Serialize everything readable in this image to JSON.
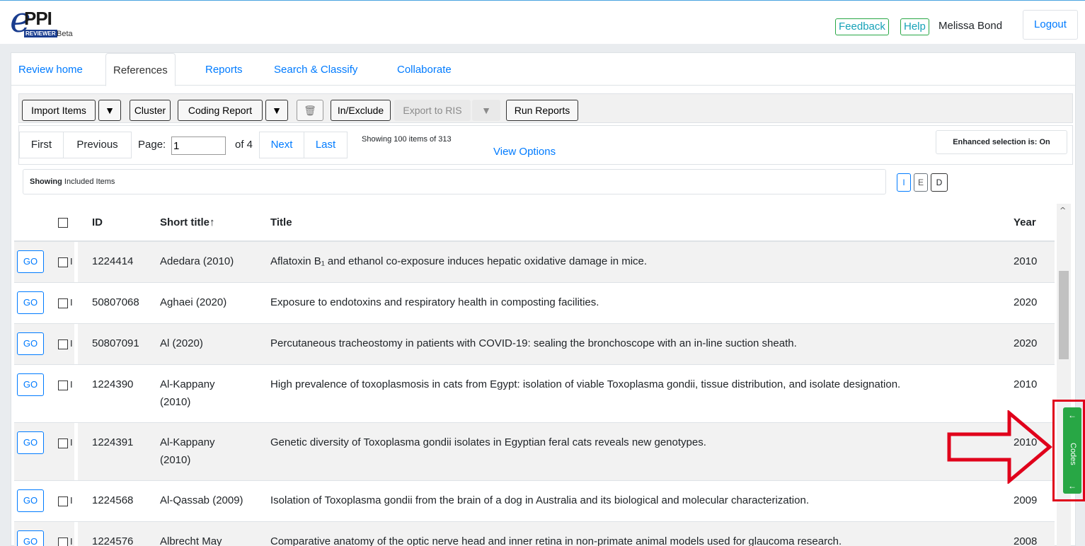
{
  "header": {
    "logo_text": "PPI",
    "logo_sub": "REVIEWER",
    "logo_beta": "Beta",
    "feedback_label": "Feedback",
    "help_label": "Help",
    "user_name": "Melissa Bond",
    "logout_label": "Logout"
  },
  "tabs": [
    "Review home",
    "References",
    "Reports",
    "Search & Classify",
    "Collaborate"
  ],
  "active_tab": "References",
  "toolbar": {
    "import_label": "Import Items",
    "import_caret": "▼",
    "cluster_label": "Cluster",
    "coding_report_label": "Coding Report",
    "coding_caret": "▼",
    "delete_icon": "trash-icon",
    "inexclude_label": "In/Exclude",
    "export_label": "Export to RIS",
    "export_caret": "▼",
    "run_reports_label": "Run Reports"
  },
  "pager": {
    "first": "First",
    "previous": "Previous",
    "page_label": "Page:",
    "page_value": "1",
    "of_label": "of 4",
    "next": "Next",
    "last": "Last",
    "showing": "Showing 100 items of 313",
    "view_options": "View Options",
    "enhanced_label": "Enhanced selection is:",
    "enhanced_value": "On"
  },
  "filter": {
    "showing_bold": "Showing",
    "showing_text": "Included Items",
    "buttons": [
      "I",
      "E",
      "D"
    ],
    "active": "I"
  },
  "table": {
    "headers": {
      "id": "ID",
      "short_title": "Short title↑",
      "title": "Title",
      "year": "Year"
    },
    "go_label": "GO",
    "rows": [
      {
        "flag": "I",
        "id": "1224414",
        "short_title": "Adedara (2010)",
        "title": "Aflatoxin B₁ and ethanol co-exposure induces hepatic oxidative damage in mice.",
        "year": "2010"
      },
      {
        "flag": "I",
        "id": "50807068",
        "short_title": "Aghaei (2020)",
        "title": "Exposure to endotoxins and respiratory health in composting facilities.",
        "year": "2020"
      },
      {
        "flag": "I",
        "id": "50807091",
        "short_title": "Al (2020)",
        "title": "Percutaneous tracheostomy in patients with COVID-19: sealing the bronchoscope with an in-line suction sheath.",
        "year": "2020"
      },
      {
        "flag": "I",
        "id": "1224390",
        "short_title": "Al-Kappany (2010)",
        "title": "High prevalence of toxoplasmosis in cats from Egypt: isolation of viable Toxoplasma gondii, tissue distribution, and isolate designation.",
        "year": "2010"
      },
      {
        "flag": "I",
        "id": "1224391",
        "short_title": "Al-Kappany (2010)",
        "title": "Genetic diversity of Toxoplasma gondii isolates in Egyptian feral cats reveals new genotypes.",
        "year": "2010"
      },
      {
        "flag": "I",
        "id": "1224568",
        "short_title": "Al-Qassab (2009)",
        "title": "Isolation of Toxoplasma gondii from the brain of a dog in Australia and its biological and molecular characterization.",
        "year": "2009"
      },
      {
        "flag": "I",
        "id": "1224576",
        "short_title": "Albrecht May",
        "title": "Comparative anatomy of the optic nerve head and inner retina in non-primate animal models used for glaucoma research.",
        "year": "2008"
      }
    ]
  },
  "codes_tab": {
    "label": "Codes",
    "arrow": "🡐"
  },
  "annotation": {
    "arrow_color": "#e0001b"
  },
  "colors": {
    "primary": "#007bff",
    "success": "#28a745",
    "annotation": "#e0001b"
  }
}
